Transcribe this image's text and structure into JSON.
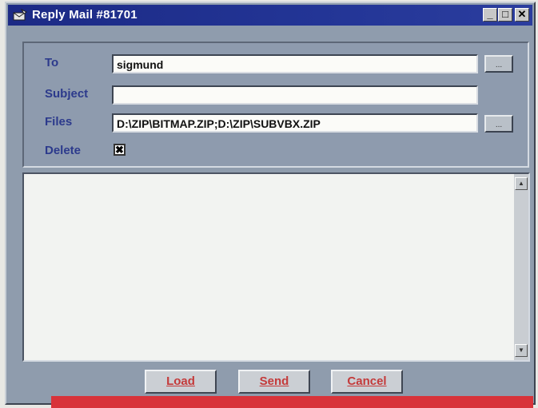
{
  "window": {
    "title": "Reply Mail #81701",
    "controls": {
      "minimize": "_",
      "maximize": "□",
      "close": "✕"
    }
  },
  "form": {
    "to": {
      "label": "To",
      "value": "sigmund",
      "browse_label": "..."
    },
    "subject": {
      "label": "Subject",
      "value": ""
    },
    "files": {
      "label": "Files",
      "value": "D:\\ZIP\\BITMAP.ZIP;D:\\ZIP\\SUBVBX.ZIP",
      "browse_label": "..."
    },
    "delete": {
      "label": "Delete",
      "checked_glyph": "✖"
    }
  },
  "body": {
    "text": "",
    "scroll_up": "▲",
    "scroll_down": "▼"
  },
  "buttons": {
    "load": "Load",
    "send": "Send",
    "cancel": "Cancel"
  },
  "colors": {
    "titlebar": "#1c2a85",
    "label_text": "#2c3a8c",
    "button_text": "#c43a3a",
    "caption_strip": "#d8333a"
  }
}
